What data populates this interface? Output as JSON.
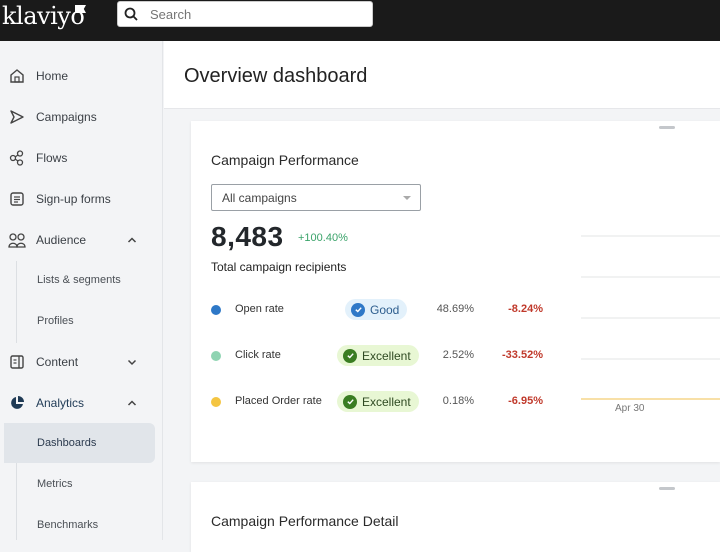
{
  "app": {
    "logo": "klaviyo"
  },
  "search": {
    "placeholder": "Search"
  },
  "sidebar": {
    "items": [
      {
        "label": "Home",
        "icon": "home-icon"
      },
      {
        "label": "Campaigns",
        "icon": "send-icon"
      },
      {
        "label": "Flows",
        "icon": "flows-icon"
      },
      {
        "label": "Sign-up forms",
        "icon": "form-icon"
      },
      {
        "label": "Audience",
        "icon": "people-icon",
        "expanded": true,
        "children": [
          {
            "label": "Lists & segments"
          },
          {
            "label": "Profiles"
          }
        ]
      },
      {
        "label": "Content",
        "icon": "content-icon",
        "expanded": false
      },
      {
        "label": "Analytics",
        "icon": "pie-chart-icon",
        "expanded": true,
        "children": [
          {
            "label": "Dashboards",
            "active": true
          },
          {
            "label": "Metrics"
          },
          {
            "label": "Benchmarks"
          }
        ]
      }
    ]
  },
  "header": {
    "title": "Overview dashboard"
  },
  "card1": {
    "title": "Campaign Performance",
    "filter": {
      "selected": "All campaigns"
    },
    "total": {
      "value": "8,483",
      "delta": "+100.40%",
      "label": "Total campaign recipients"
    },
    "metrics": [
      {
        "name": "Open rate",
        "color": "#2e78c7",
        "badge": "Good",
        "badge_bg": "#e3f1fb",
        "badge_color": "#2e5e8e",
        "check_bg": "#2e78c7",
        "value": "48.69%",
        "change": "-8.24%"
      },
      {
        "name": "Click rate",
        "color": "#8fd4b2",
        "badge": "Excellent",
        "badge_bg": "#e8f7d4",
        "badge_color": "#2f4a22",
        "check_bg": "#3a7d22",
        "value": "2.52%",
        "change": "-33.52%"
      },
      {
        "name": "Placed Order rate",
        "color": "#f4c542",
        "badge": "Excellent",
        "badge_bg": "#e8f7d4",
        "badge_color": "#2f4a22",
        "check_bg": "#3a7d22",
        "value": "0.18%",
        "change": "-6.95%"
      }
    ],
    "chart": {
      "x_label": "Apr 30",
      "line_color": "#f6d58a"
    }
  },
  "card2": {
    "title": "Campaign Performance Detail"
  }
}
